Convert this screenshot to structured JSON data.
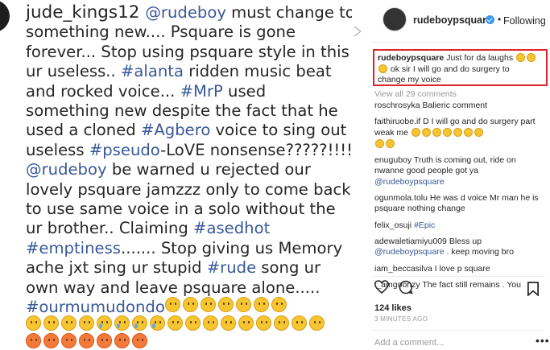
{
  "post": {
    "lines": [
      {
        "parts": [
          {
            "t": "jude_kings12 ",
            "c": "user"
          },
          {
            "t": "@rudeboy",
            "c": "hl"
          },
          {
            "t": " must change to",
            "c": ""
          }
        ]
      },
      {
        "parts": [
          {
            "t": "something new.... Psquare is gone",
            "c": ""
          }
        ]
      },
      {
        "parts": [
          {
            "t": "forever... Stop using psquare style in this",
            "c": ""
          }
        ]
      },
      {
        "parts": [
          {
            "t": "ur useless.. ",
            "c": ""
          },
          {
            "t": "#alanta",
            "c": "hl"
          },
          {
            "t": " ridden music beat",
            "c": ""
          }
        ]
      },
      {
        "parts": [
          {
            "t": "and rocked voice... ",
            "c": ""
          },
          {
            "t": "#MrP",
            "c": "hl"
          },
          {
            "t": " used",
            "c": ""
          }
        ]
      },
      {
        "parts": [
          {
            "t": "something new despite the fact that he",
            "c": ""
          }
        ]
      },
      {
        "parts": [
          {
            "t": "used a cloned ",
            "c": ""
          },
          {
            "t": "#Agbero",
            "c": "hl"
          },
          {
            "t": " voice to sing out",
            "c": ""
          }
        ]
      },
      {
        "parts": [
          {
            "t": "useless ",
            "c": ""
          },
          {
            "t": "#pseudo",
            "c": "hl"
          },
          {
            "t": "-LoVE nonsense?????!!!!",
            "c": ""
          }
        ]
      },
      {
        "parts": [
          {
            "t": "@rudeboy",
            "c": "hl"
          },
          {
            "t": " be warned u rejected our",
            "c": ""
          }
        ]
      },
      {
        "parts": [
          {
            "t": "lovely psquare jamzzz only to come back",
            "c": ""
          }
        ]
      },
      {
        "parts": [
          {
            "t": "to use same voice in a solo without the",
            "c": ""
          }
        ]
      },
      {
        "parts": [
          {
            "t": "ur brother.. Claiming ",
            "c": ""
          },
          {
            "t": "#asedhot",
            "c": "hl"
          }
        ]
      },
      {
        "parts": [
          {
            "t": "#emptiness",
            "c": "hl"
          },
          {
            "t": "....... Stop giving us Memory",
            "c": ""
          }
        ]
      },
      {
        "parts": [
          {
            "t": "ache jxt sing ur stupid ",
            "c": ""
          },
          {
            "t": "#rude",
            "c": "hl"
          },
          {
            "t": " song ur",
            "c": ""
          }
        ]
      },
      {
        "parts": [
          {
            "t": "own way and leave psquare alone.....",
            "c": ""
          }
        ]
      },
      {
        "parts": [
          {
            "t": "#ourmumudondo",
            "c": "hl"
          }
        ]
      }
    ]
  },
  "side": {
    "username": "rudeboypsquare",
    "dot": "•",
    "follow_label": "Following",
    "featured": {
      "user": "rudeboypsquare",
      "text1": "Just for da laughs",
      "text2": "ok sir I will go and do surgery to",
      "text3": "change my voice"
    },
    "view_all": "View all 29 comments",
    "comments": [
      {
        "user": "roschrosyka",
        "text": " Balieric comment"
      },
      {
        "user": "faithiruobe.if",
        "text": " D I will go and do surgery part weak me"
      },
      {
        "user": "enuguboy",
        "text": " Truth is coming out, ride on nwanne good people got ya ",
        "mention": "@rudeboypsquare"
      },
      {
        "user": "ogunmola.tolu",
        "text": " He was d voice Mr man he is psquare nothing change"
      },
      {
        "user": "felix_osuji",
        "text": " ",
        "mention": "#Epic"
      },
      {
        "user": "adewaletiamiyu009",
        "text": " Bless up ",
        "mention": "@rudeboypsquare",
        "tail": " . keep moving bro"
      },
      {
        "user": "iam_beccasilva",
        "text": " I love p square"
      },
      {
        "user": "i_amgoonzy",
        "text": " The fact still remains . You"
      }
    ],
    "likes": "124 likes",
    "time": "3 MINUTES AGO",
    "add_comment": "Add a comment...",
    "more": "•••",
    "icons": [
      "heart-icon",
      "comment-icon",
      "bookmark-icon"
    ]
  }
}
